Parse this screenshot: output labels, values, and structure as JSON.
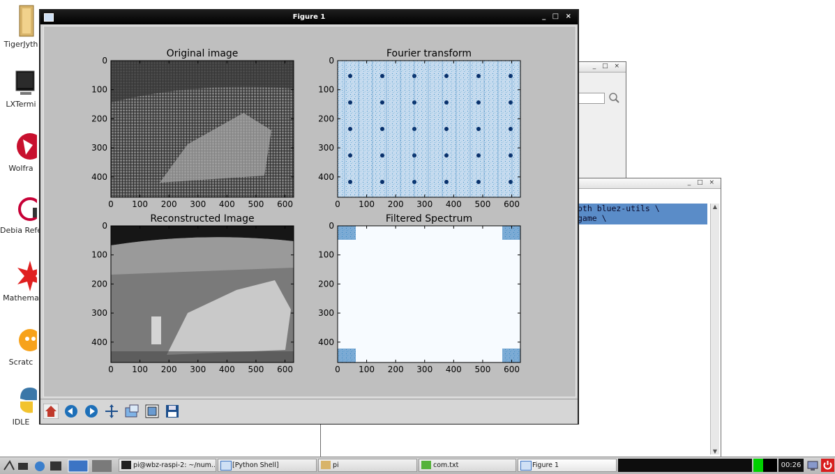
{
  "desktop": {
    "icons": [
      {
        "label": "TigerJyth"
      },
      {
        "label": "LXTermi"
      },
      {
        "label": "Wolfra"
      },
      {
        "label": "Debia Referen"
      },
      {
        "label": "Mathema"
      },
      {
        "label": "Scratc"
      },
      {
        "label": "IDLE"
      }
    ]
  },
  "back_window": {
    "code_line_1": "oth bluez-utils \\",
    "code_line_2": "game \\",
    "ctrls": "_ □ ×"
  },
  "figure": {
    "title": "Figure 1",
    "ctrls": "_ □ ×",
    "subplots": [
      {
        "title": "Original image",
        "kind": "original"
      },
      {
        "title": "Fourier transform",
        "kind": "fourier"
      },
      {
        "title": "Reconstructed Image",
        "kind": "reconstructed"
      },
      {
        "title": "Filtered Spectrum",
        "kind": "filtered"
      }
    ],
    "toolbar": [
      {
        "name": "home-button",
        "icon": "home-icon"
      },
      {
        "name": "back-button",
        "icon": "arrow-left-icon"
      },
      {
        "name": "forward-button",
        "icon": "arrow-right-icon"
      },
      {
        "name": "pan-button",
        "icon": "move-icon"
      },
      {
        "name": "zoom-button",
        "icon": "zoom-icon"
      },
      {
        "name": "subplots-button",
        "icon": "subplots-icon"
      },
      {
        "name": "save-button",
        "icon": "save-icon"
      }
    ]
  },
  "chart_data": [
    {
      "type": "heatmap",
      "title": "Original image",
      "xticks": [
        0,
        100,
        200,
        300,
        400,
        500,
        600
      ],
      "yticks": [
        0,
        100,
        200,
        300,
        400
      ],
      "xlim": [
        0,
        630
      ],
      "ylim": [
        470,
        0
      ],
      "colormap": "gray"
    },
    {
      "type": "heatmap",
      "title": "Fourier transform",
      "xticks": [
        0,
        100,
        200,
        300,
        400,
        500,
        600
      ],
      "yticks": [
        0,
        100,
        200,
        300,
        400
      ],
      "xlim": [
        0,
        630
      ],
      "ylim": [
        470,
        0
      ],
      "colormap": "Blues"
    },
    {
      "type": "heatmap",
      "title": "Reconstructed Image",
      "xticks": [
        0,
        100,
        200,
        300,
        400,
        500,
        600
      ],
      "yticks": [
        0,
        100,
        200,
        300,
        400
      ],
      "xlim": [
        0,
        630
      ],
      "ylim": [
        470,
        0
      ],
      "colormap": "gray"
    },
    {
      "type": "heatmap",
      "title": "Filtered Spectrum",
      "xticks": [
        0,
        100,
        200,
        300,
        400,
        500,
        600
      ],
      "yticks": [
        0,
        100,
        200,
        300,
        400
      ],
      "xlim": [
        0,
        630
      ],
      "ylim": [
        470,
        0
      ],
      "colormap": "Blues"
    }
  ],
  "taskbar": {
    "tasks": [
      {
        "label": "pi@wbz-raspi-2: ~/num..."
      },
      {
        "label": "[Python Shell]"
      },
      {
        "label": "pi"
      },
      {
        "label": "com.txt"
      },
      {
        "label": "Figure 1"
      }
    ],
    "clock": "00:26"
  },
  "colors": {
    "plot_blue_dark": "#08306b",
    "plot_blue_light": "#f7fbff",
    "figure_bg": "#bfbfbf"
  }
}
